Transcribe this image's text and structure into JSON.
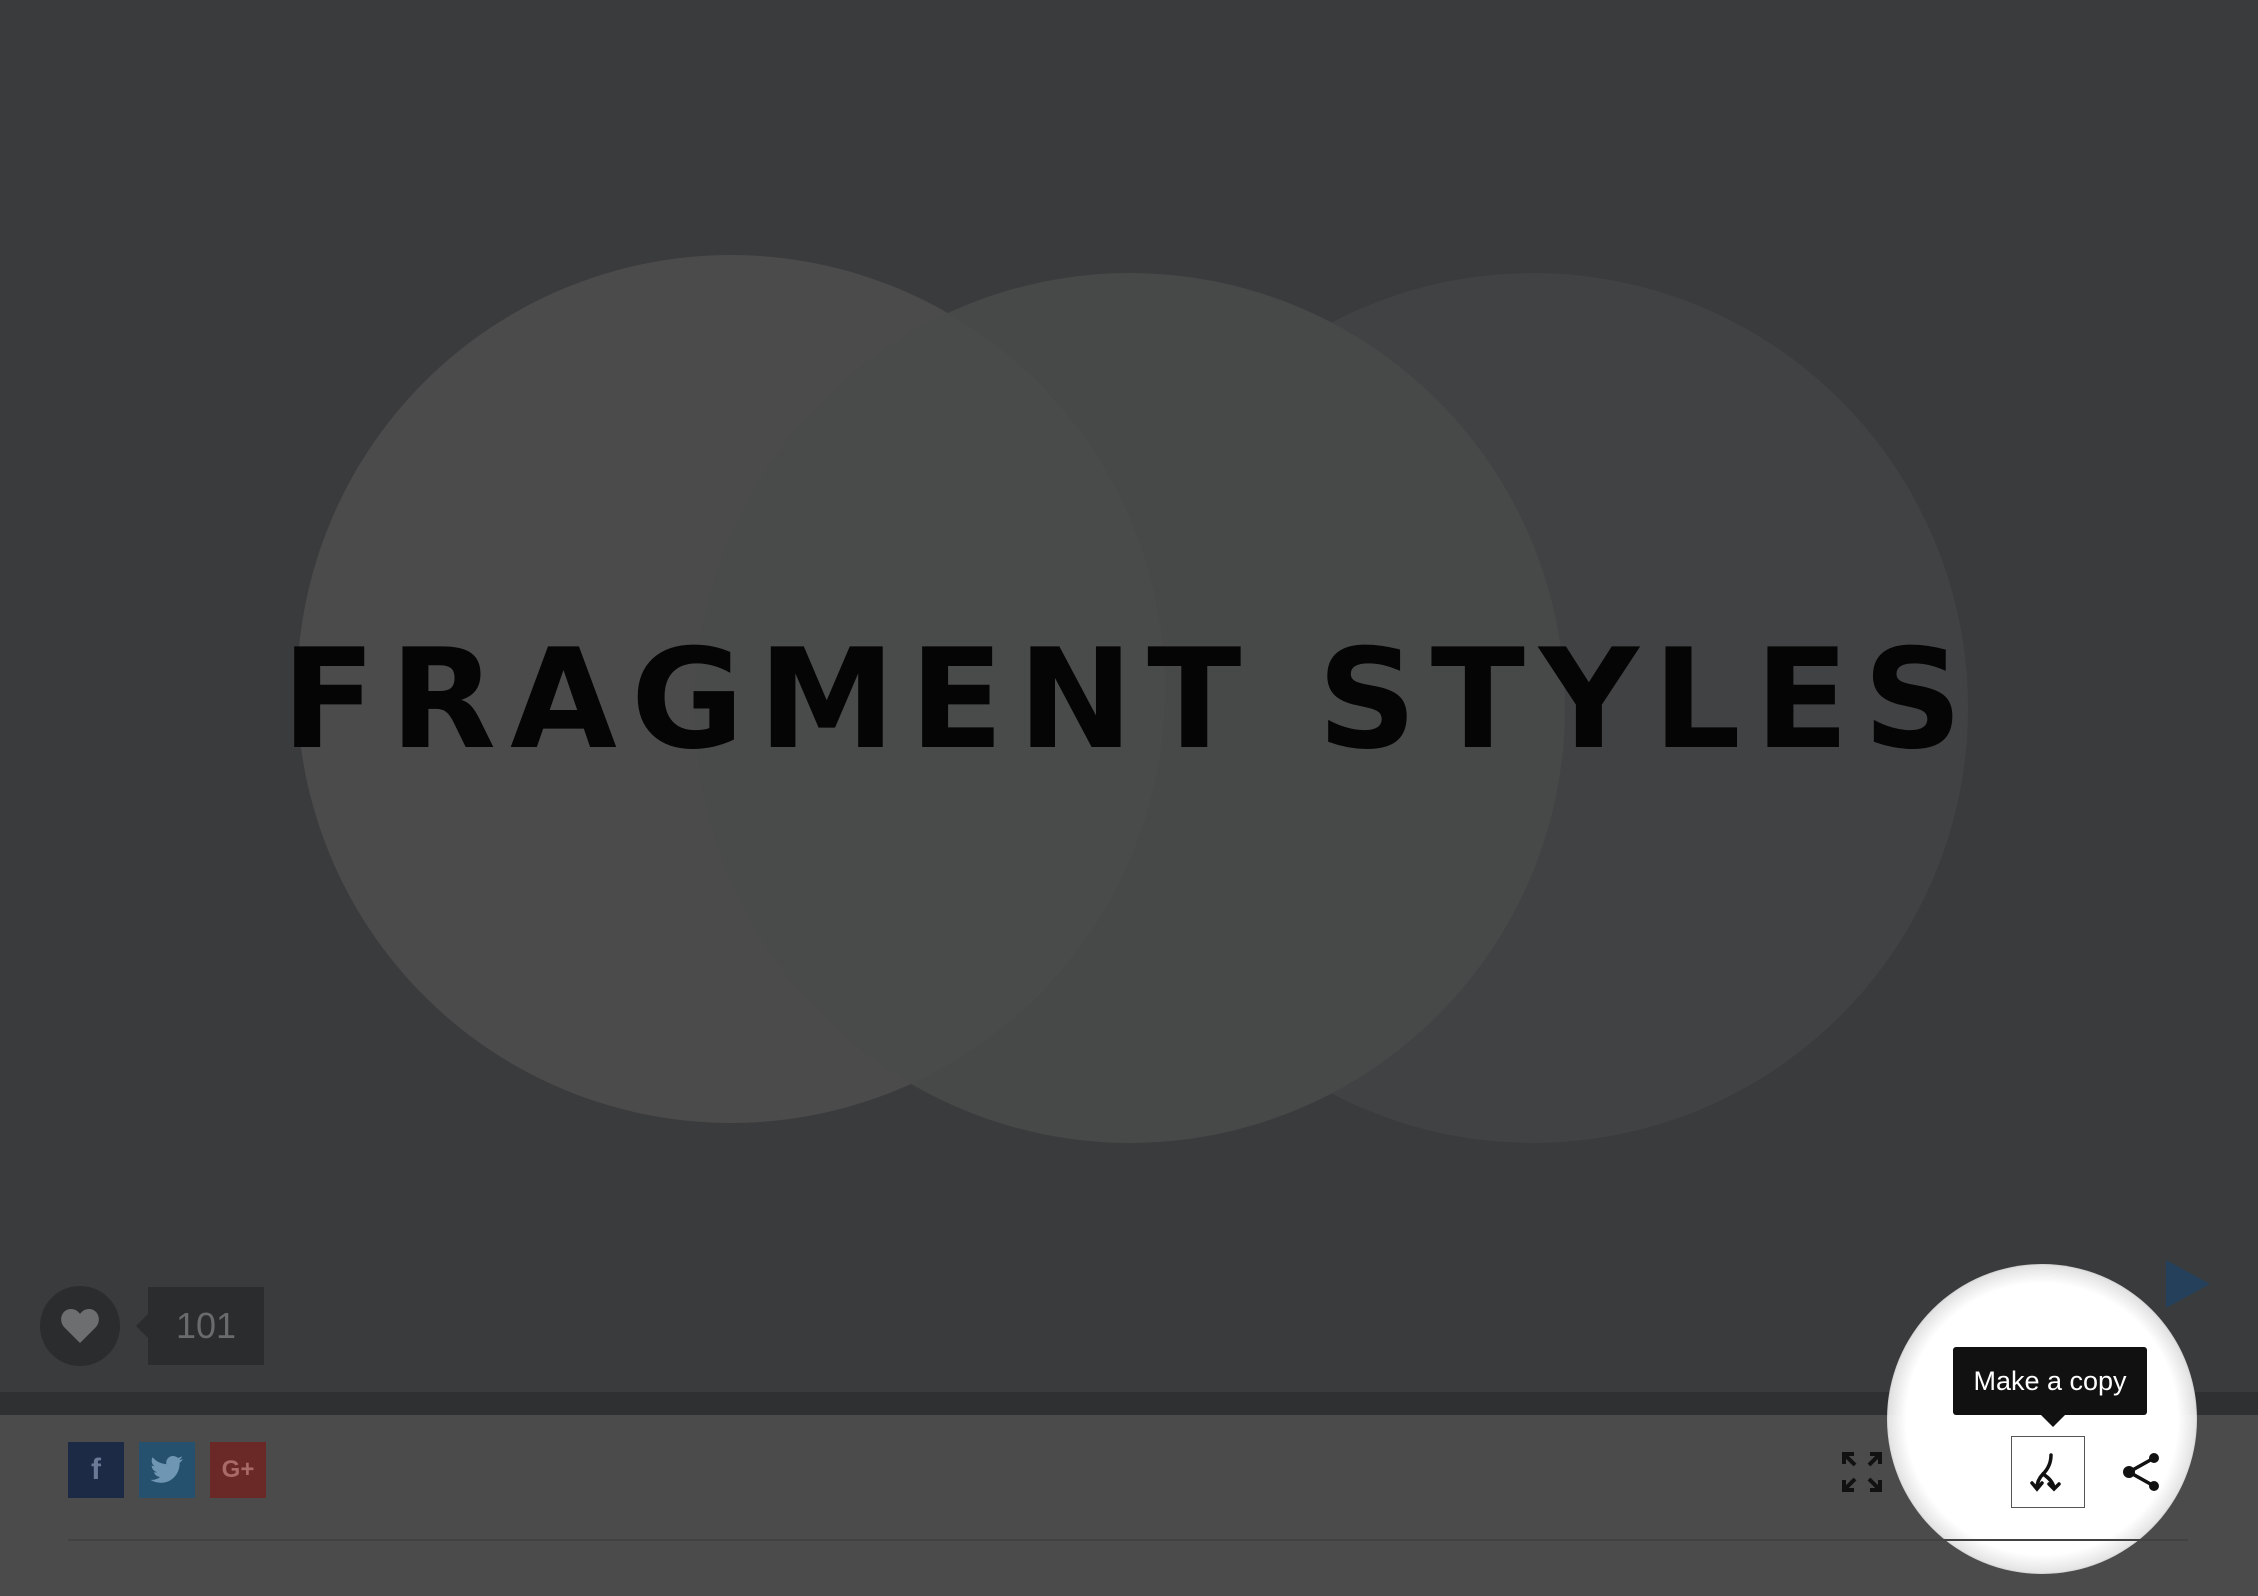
{
  "slide": {
    "title": "FRAGMENT STYLES"
  },
  "likes": {
    "count": "101",
    "icon": "heart-icon"
  },
  "navigation": {
    "next_icon": "play-arrow-icon",
    "next_color": "#24405a"
  },
  "social": {
    "facebook": {
      "label": "f",
      "icon": "facebook-icon",
      "color": "#1d2a45"
    },
    "twitter": {
      "label": "",
      "icon": "twitter-bird-icon",
      "color": "#25506e"
    },
    "google": {
      "label": "G+",
      "icon": "google-plus-icon",
      "color": "#6a2826"
    }
  },
  "toolbar": {
    "fullscreen_icon": "fullscreen-icon",
    "comment_icon": "speech-bubble-icon",
    "copy_icon": "fork-icon",
    "share_icon": "share-icon"
  },
  "tooltip": {
    "text": "Make a copy"
  },
  "colors": {
    "stage_background": "#3a3b3d",
    "toolbar_background": "#4b4b4b",
    "tooltip_background": "#111111"
  }
}
